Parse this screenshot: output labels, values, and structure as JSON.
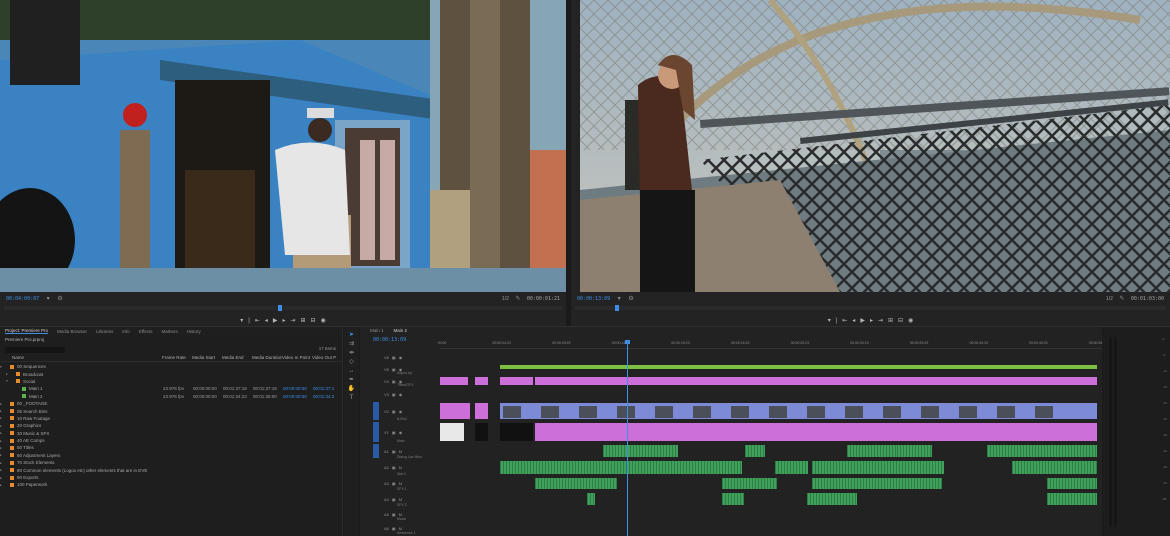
{
  "source_monitor": {
    "timecode": "00:04:00:07",
    "duration": "00:00:01:21",
    "zoom": "1/2",
    "scene": "blue-house-man"
  },
  "program_monitor": {
    "timecode": "00:00:13:09",
    "duration": "00:01:03:00",
    "zoom": "1/2",
    "scene": "bridge-woman"
  },
  "project_panel": {
    "tabs": [
      "Project: Premiere Pro",
      "Media Browser",
      "Libraries",
      "Info",
      "Effects",
      "Markers",
      "History"
    ],
    "project_name": "Premiere Pro.prproj",
    "item_count": "17 Items",
    "search_placeholder": "",
    "columns": [
      "Name",
      "Frame Rate",
      "Media Start",
      "Media End",
      "Media Duration",
      "Video In Point",
      "Video Out P"
    ],
    "bins": [
      {
        "name": "00 Sequences",
        "color": "#e88c2a",
        "level": 0,
        "open": true
      },
      {
        "name": "Broadcast",
        "color": "#e88c2a",
        "level": 1,
        "open": false
      },
      {
        "name": "Social",
        "color": "#e88c2a",
        "level": 1,
        "open": true
      },
      {
        "name": "Main 1",
        "color": "#5fae4f",
        "level": 2,
        "seq": true,
        "cells": [
          "23.976 fps",
          "00:00:00:00",
          "00:01:37:18",
          "00:01:37:19",
          "00:00:00:00",
          "00:01:37:1"
        ]
      },
      {
        "name": "Main 2",
        "color": "#5fae4f",
        "level": 2,
        "seq": true,
        "cells": [
          "23.976 fps",
          "00:00:00:00",
          "00:01:34:23",
          "00:01:35:00",
          "00:00:00:00",
          "00:01:34:2"
        ]
      },
      {
        "name": "00 _FOOTAGE",
        "color": "#e88c2a",
        "level": 0
      },
      {
        "name": "05 Search Bins",
        "color": "#e88c2a",
        "level": 0
      },
      {
        "name": "10 Raw Footage",
        "color": "#e88c2a",
        "level": 0
      },
      {
        "name": "20 Graphics",
        "color": "#e88c2a",
        "level": 0
      },
      {
        "name": "30 Music & SFX",
        "color": "#e88c2a",
        "level": 0
      },
      {
        "name": "40 AE Comps",
        "color": "#e88c2a",
        "level": 0
      },
      {
        "name": "50 Titles",
        "color": "#e88c2a",
        "level": 0
      },
      {
        "name": "60 Adjustment Layers",
        "color": "#e88c2a",
        "level": 0
      },
      {
        "name": "70 Stock Elements",
        "color": "#e88c2a",
        "level": 0
      },
      {
        "name": "80 Common elements (Logos etc) other elements that are in EVE",
        "color": "#e88c2a",
        "level": 0
      },
      {
        "name": "90 Exports",
        "color": "#e88c2a",
        "level": 0
      },
      {
        "name": "100 Paperwork",
        "color": "#e88c2a",
        "level": 0
      }
    ]
  },
  "timeline": {
    "tabs": [
      "Main 1",
      "Main 2"
    ],
    "active_tab": "Main 2",
    "timecode": "00:00:13:09",
    "ruler": [
      "00:00",
      "00:00:04:23",
      "00:00:09:23",
      "00:00:14:23",
      "00:00:19:23",
      "00:00:24:23",
      "00:00:29:23",
      "00:00:34:23",
      "00:00:39:23",
      "00:00:44:23",
      "00:00:49:23",
      "00:00:54:22"
    ],
    "track_labels": [
      "V6",
      "V5",
      "V4",
      "V3",
      "V2",
      "V1",
      "A1",
      "A2",
      "A3",
      "A4",
      "A5",
      "A6"
    ],
    "track_names": [
      "",
      "Adjust Lyr",
      "Titles/GFX",
      "",
      "B-Roll",
      "Main",
      "Dialog Lav Mics",
      "Dial 2",
      "SFX 1",
      "SFX 2",
      "Music",
      "Ambience 1"
    ]
  },
  "meters": {
    "scale": [
      "0",
      "-6",
      "-12",
      "-18",
      "-24",
      "-30",
      "-36",
      "-42",
      "-48",
      "-54",
      "dB"
    ]
  },
  "colors": {
    "accent": "#3d8ee6",
    "video_clip": "#cc6fd9",
    "broll_clip": "#7d8bd6",
    "audio_clip": "#3fa15b",
    "adjust_clip": "#7bc043"
  }
}
